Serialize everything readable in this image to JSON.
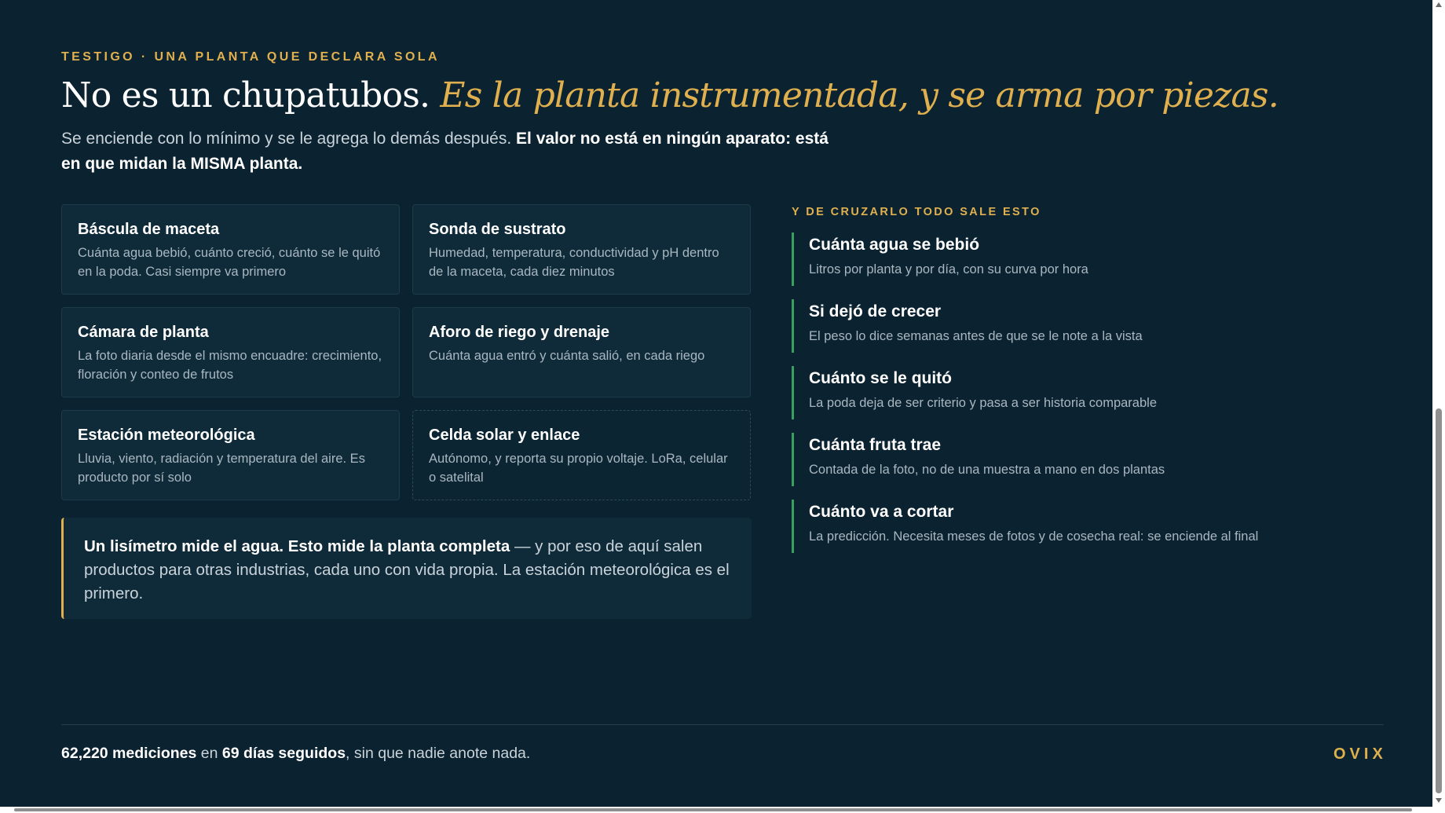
{
  "header": {
    "eyebrow": "TESTIGO · UNA PLANTA QUE DECLARA SOLA",
    "title_plain": "No es un chupatubos. ",
    "title_accent": "Es la planta instrumentada, y se arma por piezas.",
    "lead_plain": "Se enciende con lo mínimo y se le agrega lo demás después. ",
    "lead_bold": "El valor no está en ningún aparato: está en que midan la MISMA planta."
  },
  "modules": [
    {
      "title": "Báscula de maceta",
      "desc": "Cuánta agua bebió, cuánto creció, cuánto se le quitó en la poda. Casi siempre va primero"
    },
    {
      "title": "Sonda de sustrato",
      "desc": "Humedad, temperatura, conductividad y pH dentro de la maceta, cada diez minutos"
    },
    {
      "title": "Cámara de planta",
      "desc": "La foto diaria desde el mismo encuadre: crecimiento, floración y conteo de frutos"
    },
    {
      "title": "Aforo de riego y drenaje",
      "desc": "Cuánta agua entró y cuánta salió, en cada riego"
    },
    {
      "title": "Estación meteorológica",
      "desc": "Lluvia, viento, radiación y temperatura del aire. Es producto por sí solo"
    },
    {
      "title": "Celda solar y enlace",
      "desc": "Autónomo, y reporta su propio voltaje. LoRa, celular o satelital"
    }
  ],
  "note": {
    "bold": "Un lisímetro mide el agua. Esto mide la planta completa",
    "rest": " — y por eso de aquí salen productos para otras industrias, cada uno con vida propia. La estación meteorológica es el primero."
  },
  "results": {
    "eyebrow": "Y DE CRUZARLO TODO SALE ESTO",
    "items": [
      {
        "title": "Cuánta agua se bebió",
        "desc": "Litros por planta y por día, con su curva por hora"
      },
      {
        "title": "Si dejó de crecer",
        "desc": "El peso lo dice semanas antes de que se le note a la vista"
      },
      {
        "title": "Cuánto se le quitó",
        "desc": "La poda deja de ser criterio y pasa a ser historia comparable"
      },
      {
        "title": "Cuánta fruta trae",
        "desc": "Contada de la foto, no de una muestra a mano en dos plantas"
      },
      {
        "title": "Cuánto va a cortar",
        "desc": "La predicción. Necesita meses de fotos y de cosecha real: se enciende al final"
      }
    ]
  },
  "footer": {
    "count": "62,220 mediciones",
    "connector": " en ",
    "days": "69 días seguidos",
    "tail": ", sin que nadie anote nada.",
    "brand": "OVIX"
  },
  "colors": {
    "background": "#0b2230",
    "accent": "#e0b04f",
    "result_bar": "#3aa05f"
  }
}
